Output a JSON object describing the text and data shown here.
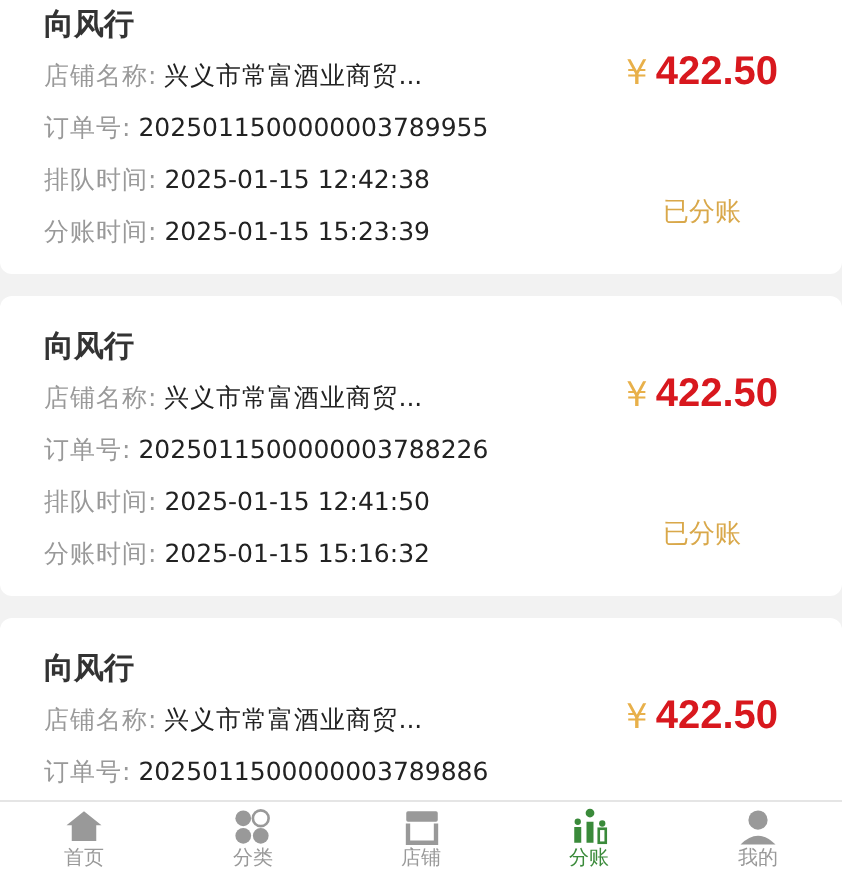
{
  "orders": [
    {
      "name": "向风行",
      "fields": [
        {
          "label": "店铺名称:",
          "value": "兴义市常富酒业商贸..."
        },
        {
          "label": "订单号:",
          "value": "2025011500000003789955"
        },
        {
          "label": "排队时间:",
          "value": "2025-01-15 12:42:38"
        },
        {
          "label": "分账时间:",
          "value": "2025-01-15 15:23:39"
        }
      ],
      "currency": "¥",
      "amount": "422.50",
      "status": "已分账"
    },
    {
      "name": "向风行",
      "fields": [
        {
          "label": "店铺名称:",
          "value": "兴义市常富酒业商贸..."
        },
        {
          "label": "订单号:",
          "value": "2025011500000003788226"
        },
        {
          "label": "排队时间:",
          "value": "2025-01-15 12:41:50"
        },
        {
          "label": "分账时间:",
          "value": "2025-01-15 15:16:32"
        }
      ],
      "currency": "¥",
      "amount": "422.50",
      "status": "已分账"
    },
    {
      "name": "向风行",
      "fields": [
        {
          "label": "店铺名称:",
          "value": "兴义市常富酒业商贸..."
        },
        {
          "label": "订单号:",
          "value": "2025011500000003789886"
        }
      ],
      "currency": "¥",
      "amount": "422.50"
    }
  ],
  "tabs": [
    {
      "label": "首页",
      "kind": "home",
      "selected": false
    },
    {
      "label": "分类",
      "kind": "category",
      "selected": false
    },
    {
      "label": "店铺",
      "kind": "store",
      "selected": false
    },
    {
      "label": "分账",
      "kind": "split",
      "selected": true
    },
    {
      "label": "我的",
      "kind": "profile",
      "selected": false
    }
  ]
}
